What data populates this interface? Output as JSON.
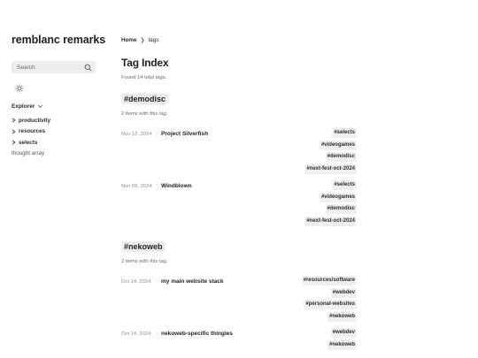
{
  "sidebar": {
    "site_title": "remblanc remarks",
    "search_placeholder": "Search",
    "explorer_label": "Explorer",
    "folders": [
      {
        "label": "productivity"
      },
      {
        "label": "resources"
      },
      {
        "label": "selects"
      }
    ],
    "file": "thought array",
    "icons": [
      "search-icon",
      "sun-icon",
      "chevron-down-icon",
      "chevron-right-icon"
    ]
  },
  "breadcrumb": {
    "home": "Home",
    "separator": "❯",
    "current": "tags"
  },
  "page": {
    "title": "Tag Index",
    "found": "Found 14 total tags."
  },
  "sections": [
    {
      "heading": "#demodisc",
      "count": "2 items with this tag.",
      "entries": [
        {
          "date": "Nov 12, 2024",
          "title": "Project Silverfish",
          "tags": [
            "#selects",
            "#videogames",
            "#demodisc",
            "#next-fest-oct-2024"
          ]
        },
        {
          "date": "Nov 09, 2024",
          "title": "Windblown",
          "tags": [
            "#selects",
            "#videogames",
            "#demodisc",
            "#next-fest-oct-2024"
          ]
        }
      ]
    },
    {
      "heading": "#nekoweb",
      "count": "2 items with this tag.",
      "entries": [
        {
          "date": "Oct 14, 2024",
          "title": "my main website stack",
          "tags": [
            "#resources/software",
            "#webdev",
            "#personal-websites",
            "#nekoweb"
          ]
        },
        {
          "date": "Oct 14, 2024",
          "title": "nekoweb-specific thingies",
          "tags": [
            "#webdev",
            "#nekoweb"
          ]
        }
      ]
    }
  ],
  "colors": {
    "text": "#1f1f1f",
    "muted": "#6a6a6a",
    "pill_bg": "#efefef",
    "search_bg": "#ececec"
  }
}
